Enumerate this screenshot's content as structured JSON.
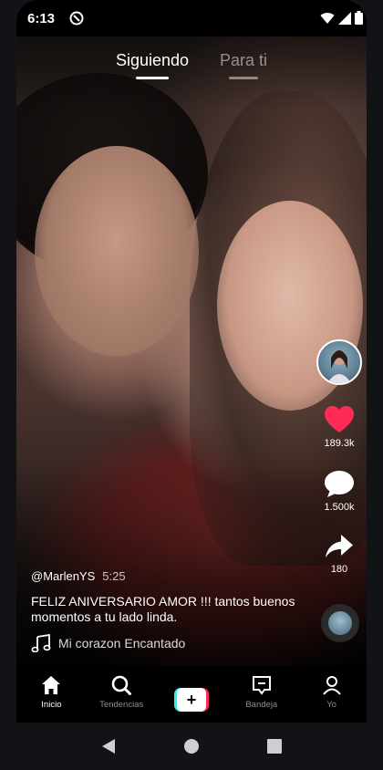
{
  "status_bar": {
    "time": "6:13"
  },
  "top_tabs": [
    {
      "label": "Siguiendo",
      "active": true
    },
    {
      "label": "Para ti",
      "active": false
    }
  ],
  "rail": {
    "likes": "189.3k",
    "comments": "1.500k",
    "shares": "180"
  },
  "caption": {
    "username": "@MarlenYS",
    "duration": "5:25",
    "text": "FELIZ ANIVERSARIO AMOR !!! tantos buenos momentos a tu lado linda.",
    "sound": "Mi corazon Encantado"
  },
  "bottom_nav": [
    {
      "label": "Inicio",
      "icon": "home-icon",
      "active": true
    },
    {
      "label": "Tendencias",
      "icon": "search-icon",
      "active": false
    },
    {
      "label": "",
      "icon": "create-icon",
      "active": false
    },
    {
      "label": "Bandeja",
      "icon": "inbox-icon",
      "active": false
    },
    {
      "label": "Yo",
      "icon": "profile-icon",
      "active": false
    }
  ],
  "colors": {
    "like": "#fe2c55",
    "create_left": "#25f4ee",
    "create_right": "#fe2c55"
  }
}
